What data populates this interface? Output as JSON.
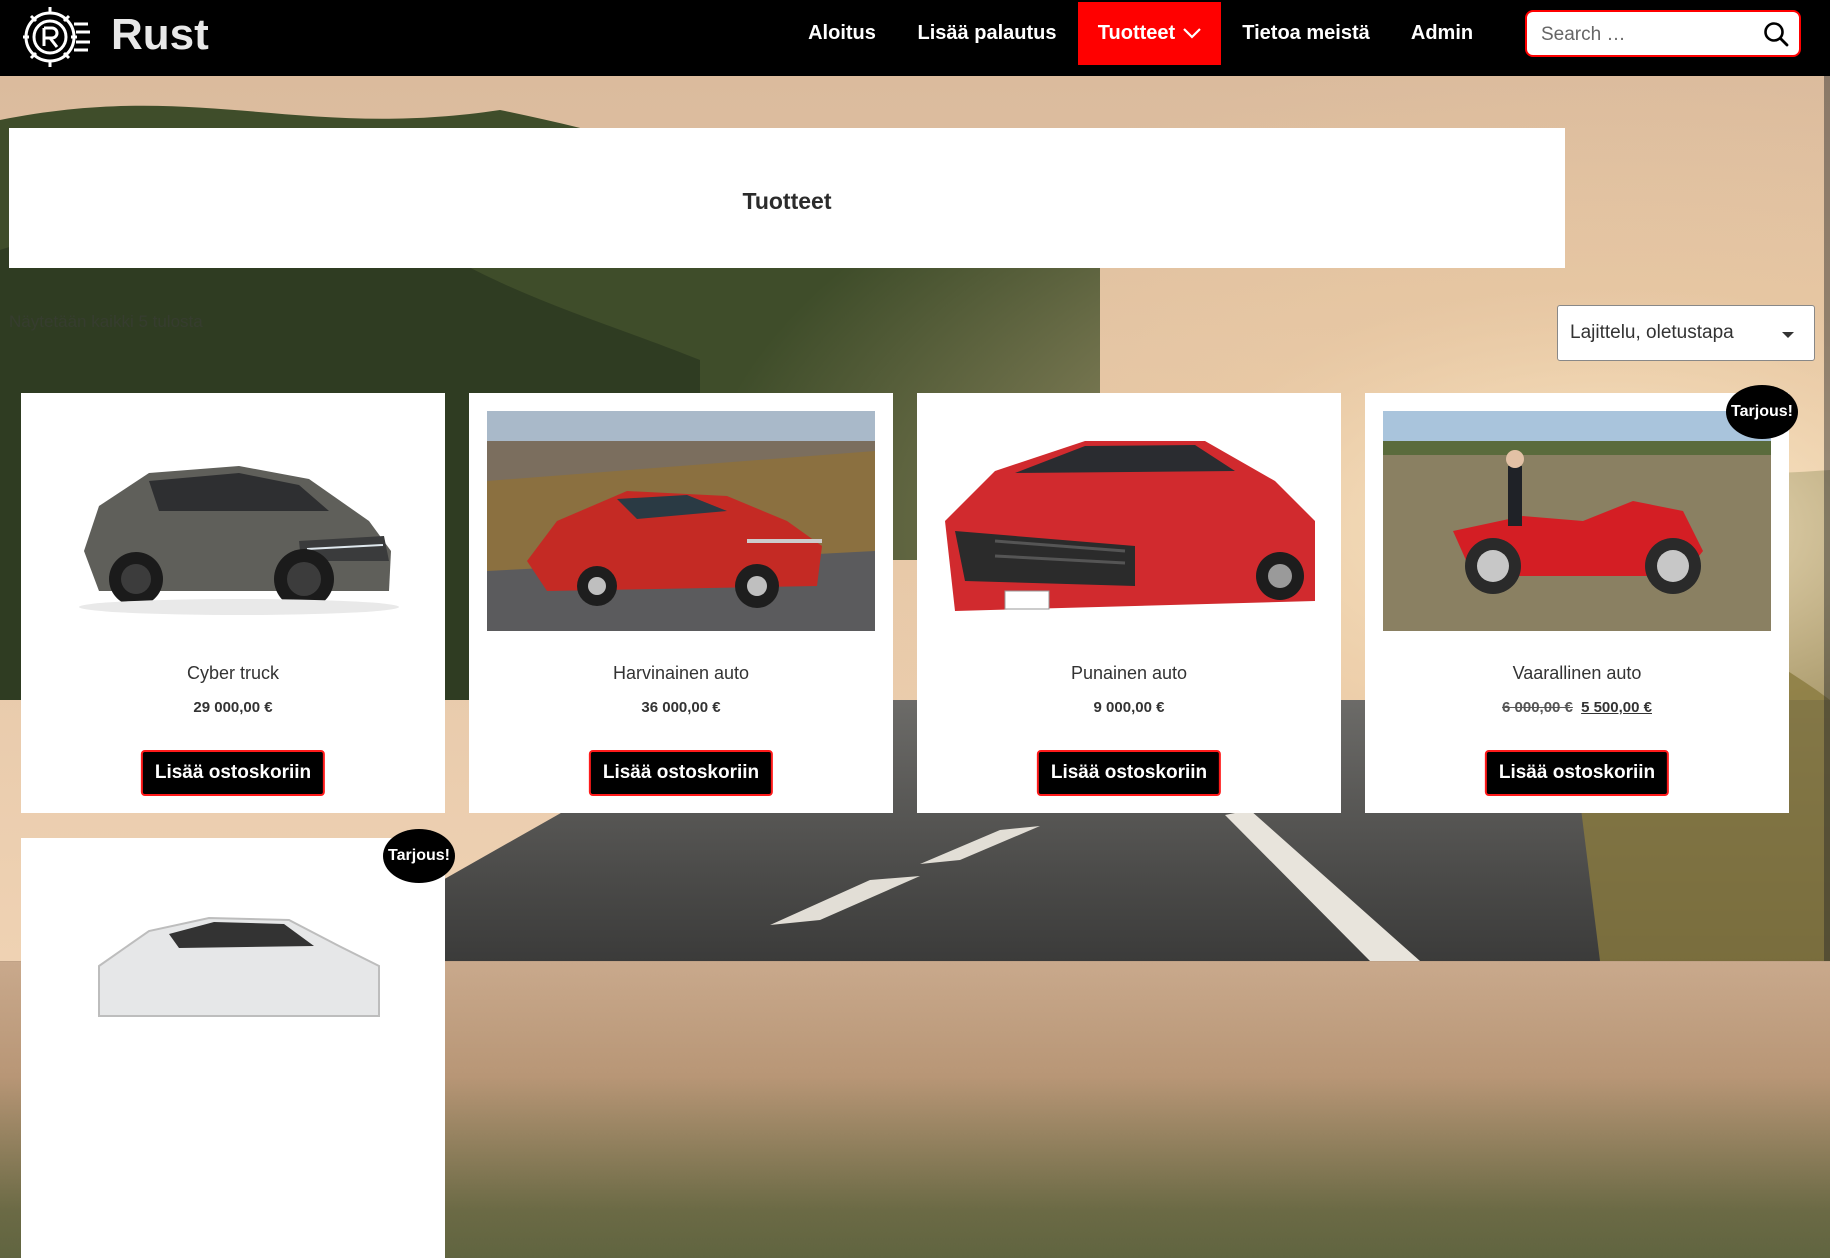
{
  "header": {
    "brand": "Rust",
    "nav": [
      {
        "label": "Aloitus",
        "active": false
      },
      {
        "label": "Lisää palautus",
        "active": false
      },
      {
        "label": "Tuotteet",
        "active": true,
        "has_dropdown": true
      },
      {
        "label": "Tietoa meistä",
        "active": false
      },
      {
        "label": "Admin",
        "active": false
      }
    ],
    "search_placeholder": "Search …",
    "search_icon": "search-icon",
    "accent": "#ff0000"
  },
  "page": {
    "title": "Tuotteet",
    "result_count": "Näytetään kaikki 5 tulosta",
    "sort": {
      "selected": "Lajittelu, oletustapa"
    }
  },
  "products": [
    {
      "name": "Cyber truck",
      "price": "29 000,00 €",
      "button": "Lisää ostoskoriin",
      "sale": false
    },
    {
      "name": "Harvinainen auto",
      "price": "36 000,00 €",
      "button": "Lisää ostoskoriin",
      "sale": false
    },
    {
      "name": "Punainen auto",
      "price": "9 000,00 €",
      "button": "Lisää ostoskoriin",
      "sale": false
    },
    {
      "name": "Vaarallinen auto",
      "old_price": "6 000,00 €",
      "price": "5 500,00 €",
      "button": "Lisää ostoskoriin",
      "sale": true,
      "badge": "Tarjous!"
    },
    {
      "name": "",
      "sale": true,
      "badge": "Tarjous!"
    }
  ]
}
